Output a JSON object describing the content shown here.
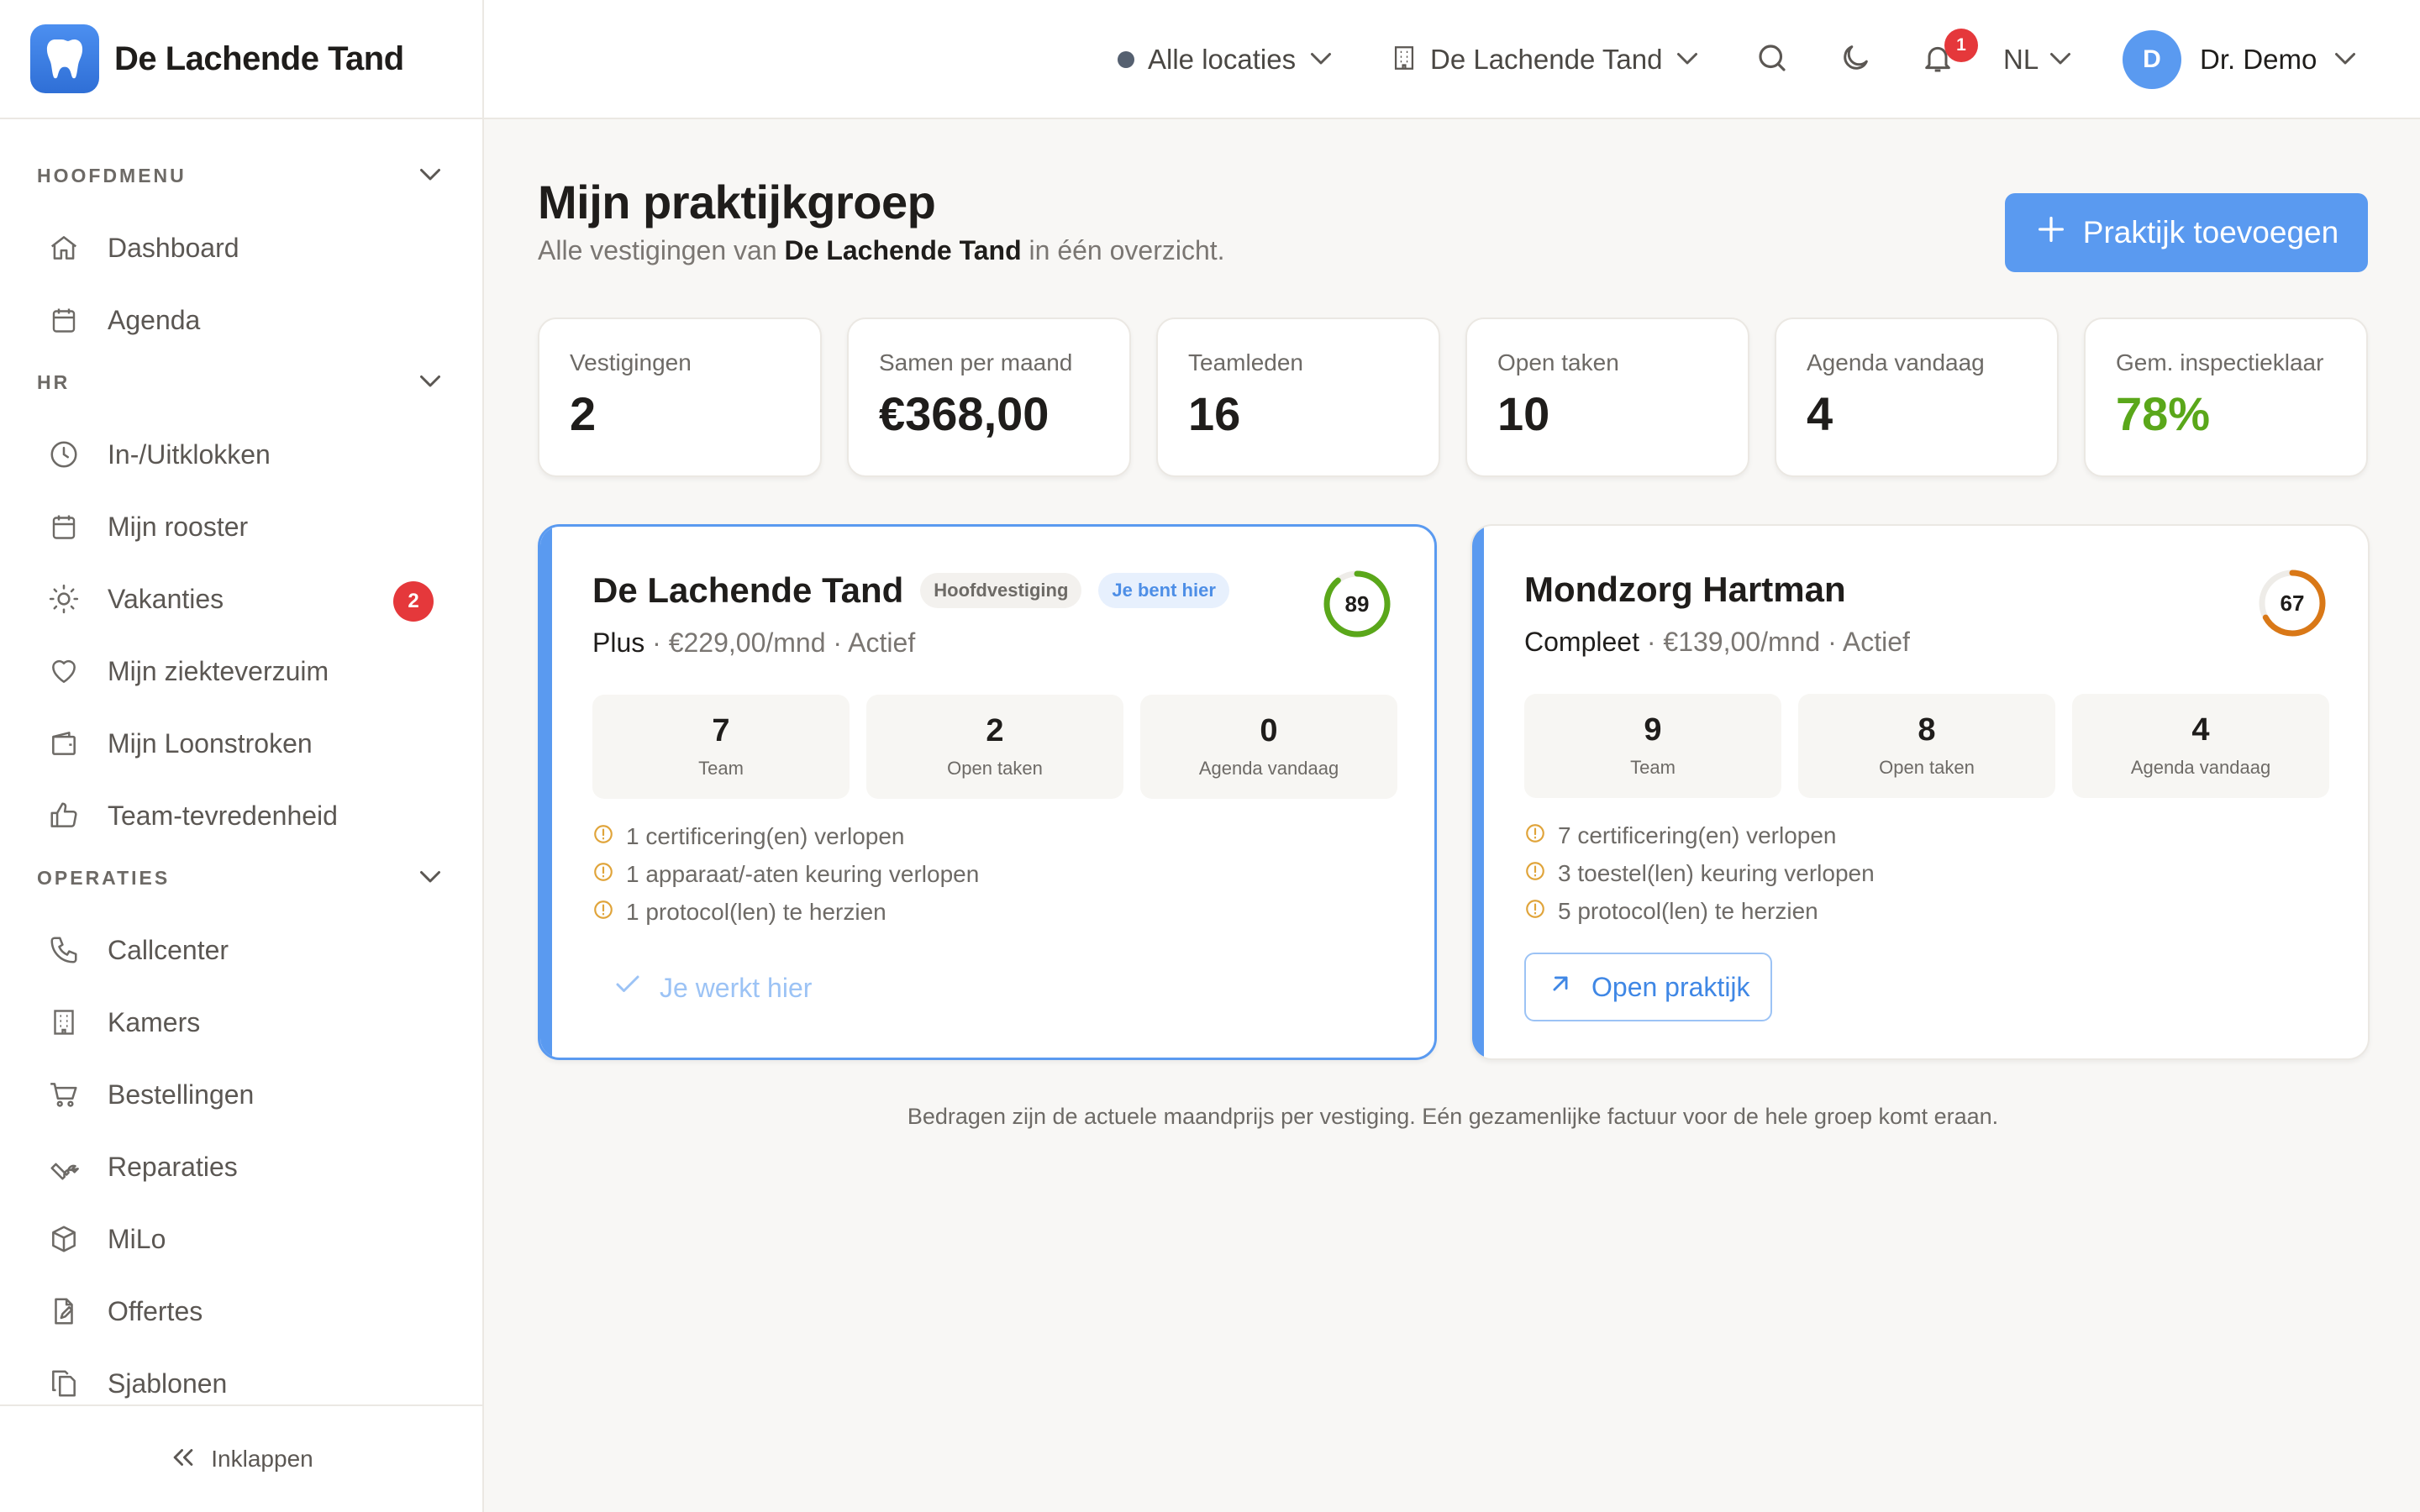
{
  "app": {
    "name": "De Lachende Tand"
  },
  "sidebar": {
    "sections": [
      {
        "title": "HOOFDMENU",
        "items": [
          {
            "label": "Dashboard",
            "icon": "home-icon"
          },
          {
            "label": "Agenda",
            "icon": "calendar-icon"
          }
        ]
      },
      {
        "title": "HR",
        "items": [
          {
            "label": "In-/Uitklokken",
            "icon": "clock-icon"
          },
          {
            "label": "Mijn rooster",
            "icon": "calendar-icon"
          },
          {
            "label": "Vakanties",
            "icon": "sun-icon",
            "badge": "2"
          },
          {
            "label": "Mijn ziekteverzuim",
            "icon": "heart-icon"
          },
          {
            "label": "Mijn Loonstroken",
            "icon": "wallet-icon"
          },
          {
            "label": "Team-tevredenheid",
            "icon": "thumbs-up-icon"
          }
        ]
      },
      {
        "title": "OPERATIES",
        "items": [
          {
            "label": "Callcenter",
            "icon": "phone-icon"
          },
          {
            "label": "Kamers",
            "icon": "building-icon"
          },
          {
            "label": "Bestellingen",
            "icon": "cart-icon"
          },
          {
            "label": "Reparaties",
            "icon": "wrench-icon"
          },
          {
            "label": "MiLo",
            "icon": "box-icon"
          },
          {
            "label": "Offertes",
            "icon": "document-edit-icon"
          },
          {
            "label": "Sjablonen",
            "icon": "copy-icon"
          }
        ]
      }
    ],
    "collapse_label": "Inklappen"
  },
  "topbar": {
    "location": "Alle locaties",
    "practice": "De Lachende Tand",
    "notifications_count": "1",
    "language": "NL",
    "user_initial": "D",
    "user_name": "Dr. Demo"
  },
  "page": {
    "title": "Mijn praktijkgroep",
    "subtitle_prefix": "Alle vestigingen van ",
    "subtitle_bold": "De Lachende Tand",
    "subtitle_suffix": " in één overzicht.",
    "add_button": "Praktijk toevoegen"
  },
  "stats": [
    {
      "label": "Vestigingen",
      "value": "2"
    },
    {
      "label": "Samen per maand",
      "value": "€368,00"
    },
    {
      "label": "Teamleden",
      "value": "16"
    },
    {
      "label": "Open taken",
      "value": "10"
    },
    {
      "label": "Agenda vandaag",
      "value": "4"
    },
    {
      "label": "Gem. inspectieklaar",
      "value": "78%",
      "color": "#5aa71a"
    }
  ],
  "practices": [
    {
      "name": "De Lachende Tand",
      "tags": [
        "Hoofdvestiging",
        "Je bent hier"
      ],
      "plan": "Plus",
      "price": " · €229,00/mnd · Actief",
      "score": 89,
      "score_color": "#5aa71a",
      "metrics": [
        {
          "value": "7",
          "label": "Team"
        },
        {
          "value": "2",
          "label": "Open taken"
        },
        {
          "value": "0",
          "label": "Agenda vandaag"
        }
      ],
      "warnings": [
        "1 certificering(en) verlopen",
        "1 apparaat/-aten keuring verlopen",
        "1 protocol(len) te herzien"
      ],
      "action": "Je werkt hier"
    },
    {
      "name": "Mondzorg Hartman",
      "tags": [],
      "plan": "Compleet",
      "price": " · €139,00/mnd · Actief",
      "score": 67,
      "score_color": "#d97817",
      "metrics": [
        {
          "value": "9",
          "label": "Team"
        },
        {
          "value": "8",
          "label": "Open taken"
        },
        {
          "value": "4",
          "label": "Agenda vandaag"
        }
      ],
      "warnings": [
        "7 certificering(en) verlopen",
        "3 toestel(len) keuring verlopen",
        "5 protocol(len) te herzien"
      ],
      "action": "Open praktijk"
    }
  ],
  "footnote": "Bedragen zijn de actuele maandprijs per vestiging. Eén gezamenlijke factuur voor de hele groep komt eraan.",
  "colors": {
    "accent": "#5a9af0",
    "danger": "#e5383b",
    "success": "#5aa71a",
    "warning": "#d97817"
  }
}
